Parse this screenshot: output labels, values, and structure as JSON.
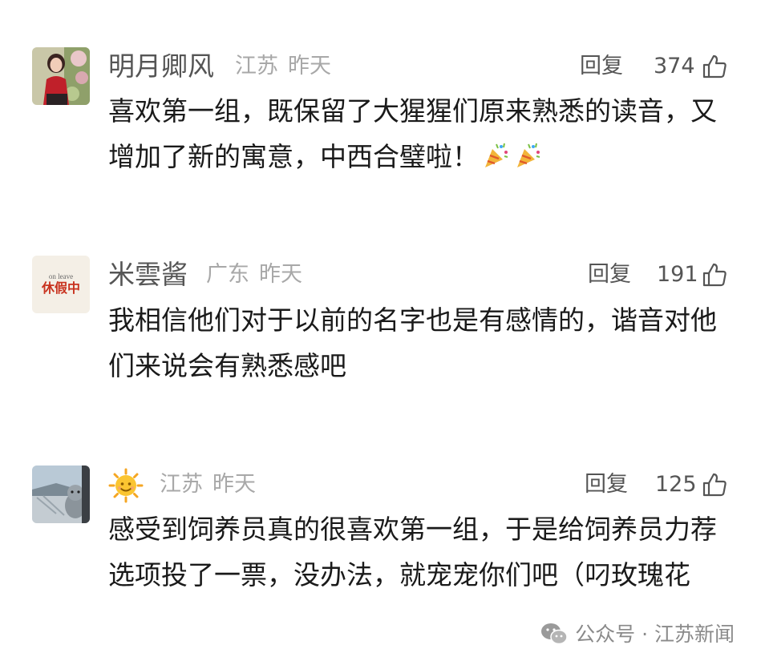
{
  "comments": [
    {
      "nickname": "明月卿风",
      "region": "江苏",
      "time": "昨天",
      "reply_label": "回复",
      "likes": "374",
      "text": "喜欢第一组，既保留了大猩猩们原来熟悉的读音，又增加了新的寓意，中西合璧啦！",
      "avatar_icon": "woman-portrait-avatar",
      "trailing_emoji": [
        "party-popper-icon",
        "party-popper-icon"
      ]
    },
    {
      "nickname": "米雲酱",
      "region": "广东",
      "time": "昨天",
      "reply_label": "回复",
      "likes": "191",
      "text": "我相信他们对于以前的名字也是有感情的，谐音对他们来说会有熟悉感吧",
      "avatar_icon": "on-leave-sign-avatar",
      "avatar_text_top": "on leave",
      "avatar_text_main": "休假中"
    },
    {
      "nickname_icon": "sun-emoji-icon",
      "region": "江苏",
      "time": "昨天",
      "reply_label": "回复",
      "likes": "125",
      "text": "感受到饲养员真的很喜欢第一组，于是给饲养员力荐选项投了一票，没办法，就宠宠你们吧（叼玫瑰花",
      "avatar_icon": "plush-toy-window-avatar"
    }
  ],
  "watermark": {
    "label": "公众号 · 江苏新闻",
    "icon": "wechat-icon"
  },
  "colors": {
    "text": "#1a1a1a",
    "nickname": "#555555",
    "meta": "#a8a8a8",
    "watermark": "#8a8a8a",
    "background": "#ffffff"
  }
}
